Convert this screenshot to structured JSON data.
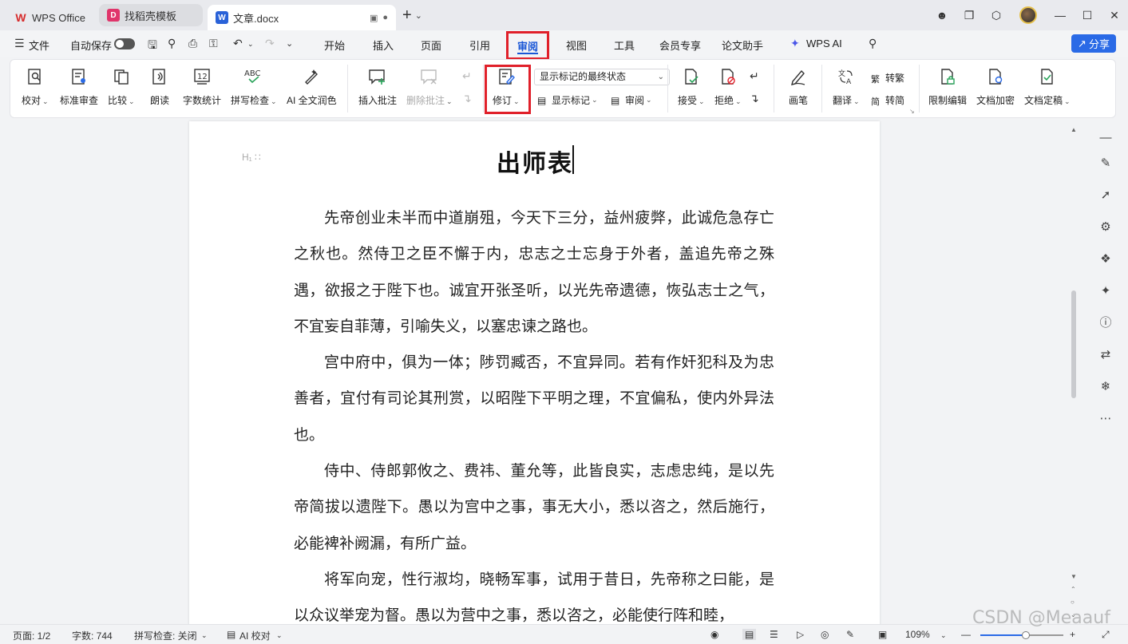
{
  "tabs": {
    "wps_office": "WPS Office",
    "template": "找稻壳模板",
    "doc": "文章.docx"
  },
  "menu": {
    "file": "文件",
    "autosave": "自动保存",
    "start": "开始",
    "insert": "插入",
    "page": "页面",
    "reference": "引用",
    "review": "审阅",
    "view": "视图",
    "tools": "工具",
    "member": "会员专享",
    "thesis": "论文助手",
    "wps_ai": "WPS AI",
    "share": "分享"
  },
  "ribbon": {
    "proofread": "校对",
    "standard_review": "标准审查",
    "compare": "比较",
    "read_aloud": "朗读",
    "word_count": "字数统计",
    "spell_check": "拼写检查",
    "ai_polish": "AI 全文润色",
    "insert_comment": "插入批注",
    "delete_comment": "删除批注",
    "track_changes": "修订",
    "display_state": "显示标记的最终状态",
    "show_markup": "显示标记",
    "review_pane": "审阅",
    "accept": "接受",
    "reject": "拒绝",
    "pen": "画笔",
    "translate": "翻译",
    "to_traditional": "转繁",
    "to_simplified": "转简",
    "restrict_edit": "限制编辑",
    "encrypt": "文档加密",
    "finalize": "文档定稿",
    "word_count_icon_num": "12",
    "spell_icon_text": "ABC"
  },
  "document": {
    "heading_marker": "H₁ ∷",
    "title": "出师表",
    "paragraphs": [
      "先帝创业未半而中道崩殂，今天下三分，益州疲弊，此诚危急存亡之秋也。然侍卫之臣不懈于内，忠志之士忘身于外者，盖追先帝之殊遇，欲报之于陛下也。诚宜开张圣听，以光先帝遗德，恢弘志士之气，不宜妄自菲薄，引喻失义，以塞忠谏之路也。",
      "宫中府中，俱为一体；陟罚臧否，不宜异同。若有作奸犯科及为忠善者，宜付有司论其刑赏，以昭陛下平明之理，不宜偏私，使内外异法也。",
      "侍中、侍郎郭攸之、费祎、董允等，此皆良实，志虑忠纯，是以先帝简拔以遗陛下。愚以为宫中之事，事无大小，悉以咨之，然后施行，必能裨补阙漏，有所广益。",
      "将军向宠，性行淑均，晓畅军事，试用于昔日，先帝称之曰能，是以众议举宠为督。愚以为营中之事，悉以咨之，必能使行阵和睦，"
    ]
  },
  "status": {
    "page": "页面: 1/2",
    "words": "字数: 744",
    "spell": "拼写检查: 关闭",
    "ai_proof": "AI 校对",
    "zoom": "109%",
    "zoom_level": 0.55
  },
  "watermark": "CSDN @Meaauf",
  "colors": {
    "accent": "#1a57d6",
    "highlight_border": "#e0202a",
    "share_bg": "#2a6ae6"
  }
}
